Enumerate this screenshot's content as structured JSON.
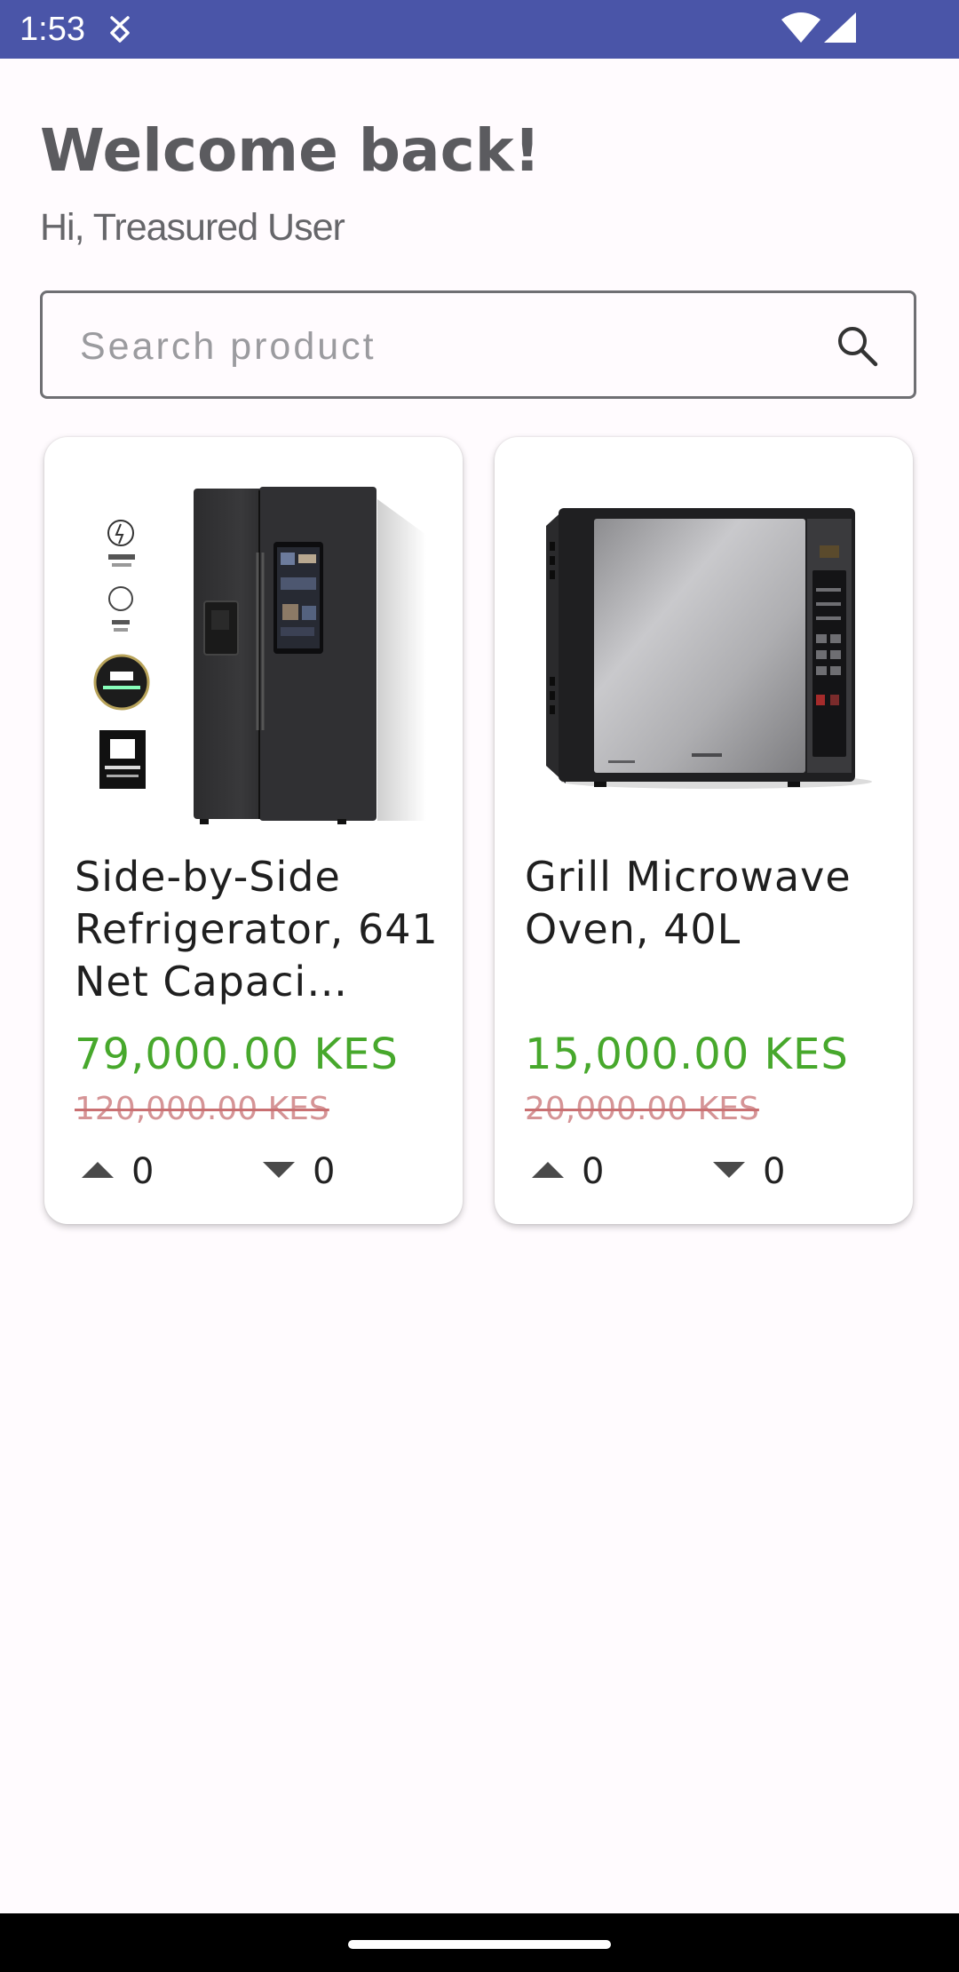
{
  "status_bar": {
    "time": "1:53",
    "icons": [
      "debug-icon",
      "wifi-icon",
      "signal-icon"
    ],
    "background_color": "#4a55a8"
  },
  "header": {
    "title": "Welcome back!",
    "subtitle": "Hi, Treasured User"
  },
  "search": {
    "placeholder": "Search product",
    "value": "",
    "icon": "search-icon"
  },
  "products": [
    {
      "image_icon": "refrigerator-image",
      "title": "Side-by-Side Refrigerator, 641 Net Capaci…",
      "price": "79,000.00 KES",
      "old_price": "120,000.00 KES",
      "upvotes": "0",
      "downvotes": "0"
    },
    {
      "image_icon": "microwave-image",
      "title": "Grill Microwave Oven, 40L",
      "price": "15,000.00 KES",
      "old_price": "20,000.00 KES",
      "upvotes": "0",
      "downvotes": "0"
    }
  ],
  "colors": {
    "price": "#47a82c",
    "old_price": "#d59496",
    "background": "#fffbfe"
  }
}
